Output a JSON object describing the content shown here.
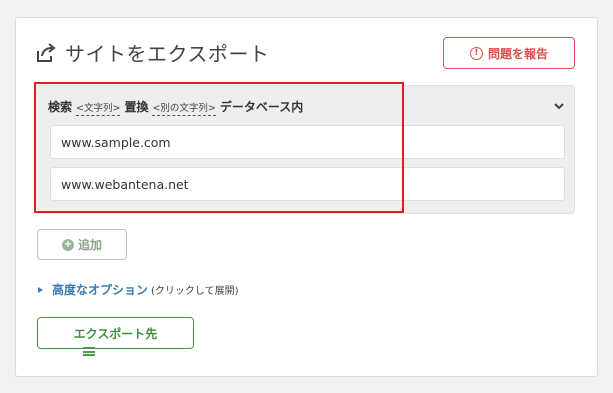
{
  "panel": {
    "title": "サイトをエクスポート",
    "report_button": "問題を報告"
  },
  "search_replace": {
    "search_label": "検索",
    "search_hint": "<文字列>",
    "replace_label": "置換",
    "replace_hint": "<別の文字列>",
    "scope_label": "データベース内",
    "search_value": "www.sample.com",
    "replace_value": "www.webantena.net"
  },
  "actions": {
    "add_label": "追加",
    "advanced_label": "高度なオプション",
    "advanced_note": "(クリックして展開)",
    "export_label": "エクスポート先"
  },
  "colors": {
    "report": "#d9534f",
    "highlight": "#e02020",
    "link": "#3a7bb5",
    "export": "#4a9a4a"
  },
  "icons": [
    "export-share-icon",
    "alert-circle-icon",
    "chevron-down-icon",
    "plus-circle-icon",
    "triangle-right-icon",
    "drag-handle-icon"
  ]
}
